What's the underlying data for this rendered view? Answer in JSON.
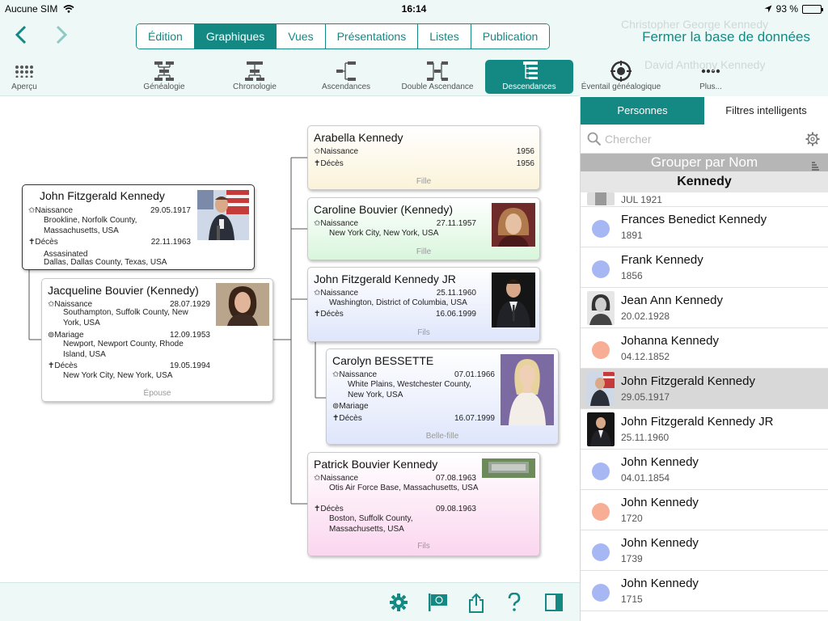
{
  "status": {
    "carrier": "Aucune SIM",
    "time": "16:14",
    "battery": "93 %",
    "battery_level": 0.93
  },
  "nav": {
    "tabs": [
      {
        "label": "Édition",
        "active": false
      },
      {
        "label": "Graphiques",
        "active": true
      },
      {
        "label": "Vues",
        "active": false
      },
      {
        "label": "Présentations",
        "active": false
      },
      {
        "label": "Listes",
        "active": false
      },
      {
        "label": "Publication",
        "active": false
      }
    ],
    "close_db": "Fermer la base de données",
    "ghost_top": "Christopher George Kennedy",
    "ghost_mid": "David Anthony Kennedy"
  },
  "toolbar": {
    "overview": "Aperçu",
    "genealogy": "Généalogie",
    "chronology": "Chronologie",
    "ancestors": "Ascendances",
    "double_ancestors": "Double Ascendance",
    "descendants": "Descendances",
    "fan": "Éventail généalogique",
    "more": "Plus..."
  },
  "sidebar": {
    "tab_persons": "Personnes",
    "tab_filters": "Filtres intelligents",
    "search_placeholder": "Chercher",
    "group_by": "Grouper par Nom",
    "section": "Kennedy",
    "partial_date": "JUL 1921",
    "items": [
      {
        "name": "Frances Benedict Kennedy",
        "date": "1891",
        "color": "#a7b7f3"
      },
      {
        "name": "Frank Kennedy",
        "date": "1856",
        "color": "#a7b7f3"
      },
      {
        "name": "Jean Ann Kennedy",
        "date": "20.02.1928",
        "color": ""
      },
      {
        "name": "Johanna Kennedy",
        "date": "04.12.1852",
        "color": "#f7ae94"
      },
      {
        "name": "John Fitzgerald Kennedy",
        "date": "29.05.1917",
        "color": ""
      },
      {
        "name": "John Fitzgerald Kennedy JR",
        "date": "25.11.1960",
        "color": ""
      },
      {
        "name": "John Kennedy",
        "date": "04.01.1854",
        "color": "#a7b7f3"
      },
      {
        "name": "John Kennedy",
        "date": "1720",
        "color": "#f7ae94"
      },
      {
        "name": "John Kennedy",
        "date": "1739",
        "color": "#a7b7f3"
      },
      {
        "name": "John Kennedy",
        "date": "1715",
        "color": "#a7b7f3"
      }
    ]
  },
  "labels": {
    "birth": "Naissance",
    "death": "Décès",
    "marriage": "Mariage"
  },
  "cards": {
    "jfk": {
      "name": "John Fitzgerald Kennedy",
      "birth_date": "29.05.1917",
      "birth_place": "Brookline, Norfolk County, Massachusetts, USA",
      "death_date": "22.11.1963",
      "death_place1": "Assasinated",
      "death_place2": "Dallas, Dallas County, Texas, USA"
    },
    "jackie": {
      "name": "Jacqueline Bouvier (Kennedy)",
      "birth_date": "28.07.1929",
      "birth_place": "Southampton, Suffolk County, New York, USA",
      "marriage_date": "12.09.1953",
      "marriage_place": "Newport, Newport County, Rhode Island, USA",
      "death_date": "19.05.1994",
      "death_place": "New York City, New York, USA",
      "role": "Épouse"
    },
    "arabella": {
      "name": "Arabella Kennedy",
      "birth_date": "1956",
      "death_date": "1956",
      "role": "Fille"
    },
    "caroline": {
      "name": "Caroline Bouvier (Kennedy)",
      "birth_date": "27.11.1957",
      "birth_place": "New York City, New York, USA",
      "role": "Fille"
    },
    "jfkjr": {
      "name": "John Fitzgerald Kennedy JR",
      "birth_date": "25.11.1960",
      "birth_place": "Washington, District of Columbia, USA",
      "death_date": "16.06.1999",
      "role": "Fils"
    },
    "carolyn": {
      "name": "Carolyn BESSETTE",
      "birth_date": "07.01.1966",
      "birth_place": "White Plains, Westchester County, New York, USA",
      "death_date": "16.07.1999",
      "role": "Belle-fille"
    },
    "patrick": {
      "name": "Patrick Bouvier Kennedy",
      "birth_date": "07.08.1963",
      "birth_place": "Otis Air Force Base, Massachusetts, USA",
      "death_date": "09.08.1963",
      "death_place": "Boston, Suffolk County, Massachusetts, USA",
      "role": "Fils"
    }
  }
}
